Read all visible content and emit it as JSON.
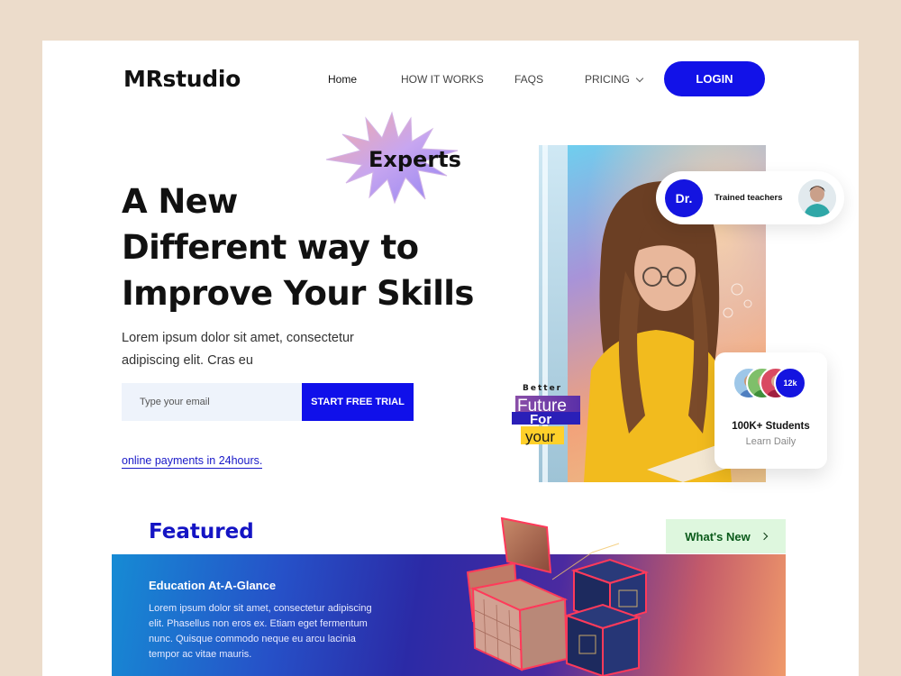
{
  "brand": {
    "logo": "MRstudio"
  },
  "nav": {
    "home": "Home",
    "how_it_works": "HOW IT WORKS",
    "faqs": "FAQS",
    "pricing": "PRICING",
    "login": "LOGIN"
  },
  "hero": {
    "badge": "Experts",
    "headline": [
      "A New",
      "Different way to",
      "Improve Your Skills"
    ],
    "subtext": "Lorem ipsum dolor sit amet, consectetur adipiscing elit. Cras eu",
    "email_placeholder": "Type your email",
    "cta": "START FREE TRIAL",
    "payments_link": "online payments in 24hours."
  },
  "teachers_card": {
    "initials": "Dr.",
    "label": "Trained teachers"
  },
  "students_card": {
    "badge": "12k",
    "count": "100K+ Students",
    "sub": "Learn Daily"
  },
  "sticker": {
    "line1": "Better",
    "line2": "Future",
    "line3": "For",
    "line4": "your"
  },
  "featured": {
    "title": "Featured",
    "whats_new": "What's New",
    "banner_title": "Education At-A-Glance",
    "banner_body": "Lorem ipsum dolor sit amet, consectetur adipiscing elit. Phasellus non eros ex. Etiam eget fermentum nunc. Quisque commodo neque eu arcu lacinia tempor ac vitae mauris."
  },
  "colors": {
    "accent": "#1212e8",
    "page_bg": "#ecdccb",
    "whats_new_bg": "#def7de"
  },
  "icons": {
    "pricing": "chevron-down-icon",
    "whats_new": "chevron-right-icon"
  }
}
